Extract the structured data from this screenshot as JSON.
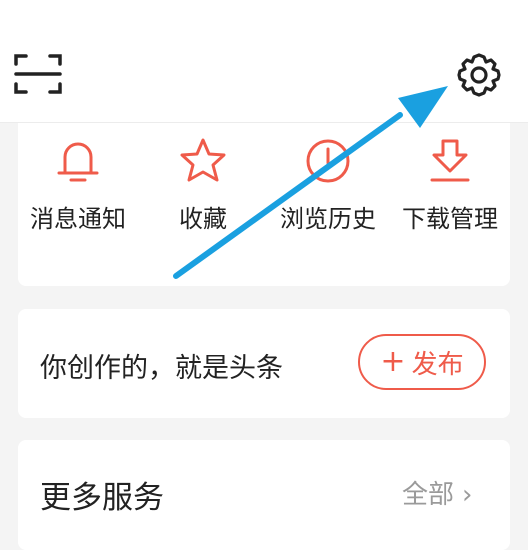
{
  "header": {
    "scan_icon": "scan-icon",
    "settings_icon": "gear-icon"
  },
  "tools": [
    {
      "label": "消息通知",
      "icon": "bell-icon"
    },
    {
      "label": "收藏",
      "icon": "star-icon"
    },
    {
      "label": "浏览历史",
      "icon": "clock-icon"
    },
    {
      "label": "下载管理",
      "icon": "download-icon"
    }
  ],
  "publish": {
    "text": "你创作的，就是头条",
    "button_plus": "+",
    "button_label": "发布"
  },
  "more": {
    "title": "更多服务",
    "all_label": "全部",
    "chevron": "›"
  },
  "colors": {
    "accent": "#ef5b4a",
    "annotation_arrow": "#1aa0e0"
  }
}
